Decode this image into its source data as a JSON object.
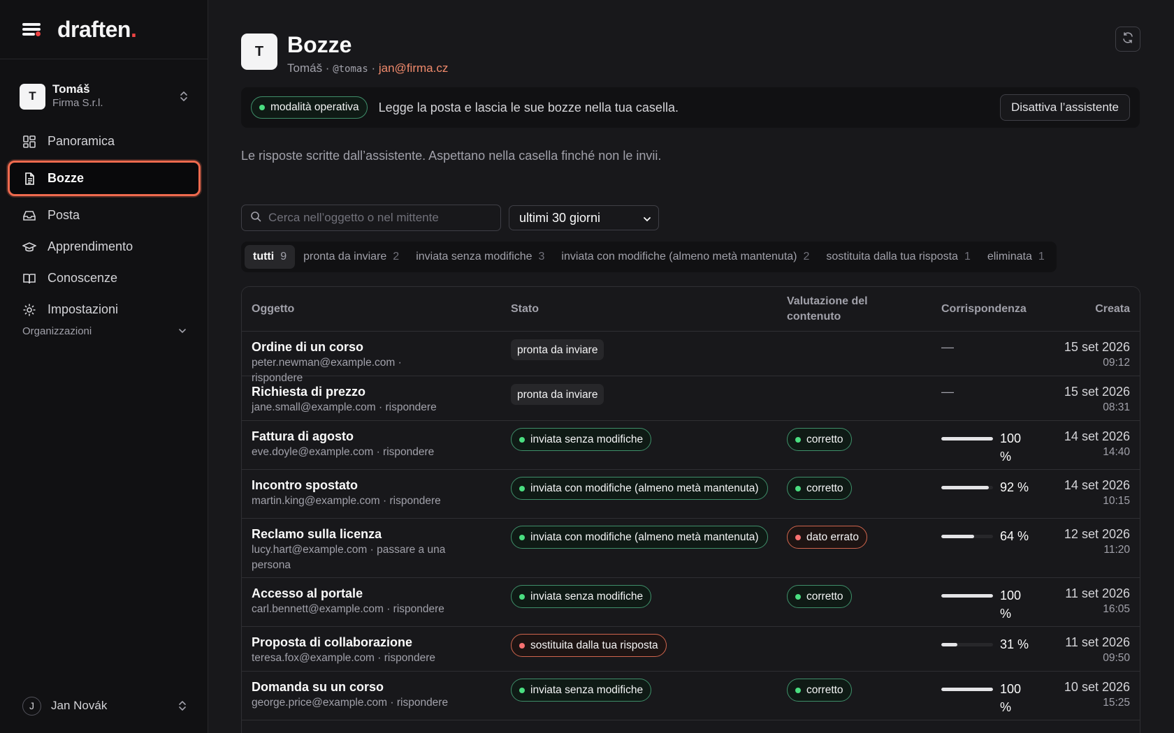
{
  "brand": {
    "logo": "draften",
    "logo_dot": "."
  },
  "account": {
    "initial": "T",
    "name": "Tomáš",
    "org": "Firma S.r.l."
  },
  "nav": [
    {
      "label": "Panoramica",
      "icon": "dashboard-icon"
    },
    {
      "label": "Bozze",
      "icon": "document-icon"
    },
    {
      "label": "Posta",
      "icon": "inbox-icon"
    },
    {
      "label": "Apprendimento",
      "icon": "graduation-cap-icon"
    },
    {
      "label": "Conoscenze",
      "icon": "book-icon"
    },
    {
      "label": "Impostazioni",
      "icon": "gear-icon"
    }
  ],
  "organizations_label": "Organizzazioni",
  "user": {
    "initial": "J",
    "name": "Jan Novák"
  },
  "header": {
    "initial": "T",
    "title": "Bozze",
    "name": "Tomáš",
    "sep1": " · ",
    "handle": "@tomas",
    "sep2": " · ",
    "email": "jan@firma.cz"
  },
  "mode": {
    "badge": "modalità operativa",
    "description": "Legge la posta e lascia le sue bozze nella tua casella.",
    "button": "Disattiva l’assistente"
  },
  "intro": "Le risposte scritte dall’assistente. Aspettano nella casella finché non le invii.",
  "search": {
    "placeholder": "Cerca nell’oggetto o nel mittente"
  },
  "period": {
    "selected": "ultimi 30 giorni"
  },
  "filters": [
    {
      "label": "tutti",
      "count": "9"
    },
    {
      "label": "pronta da inviare",
      "count": "2"
    },
    {
      "label": "inviata senza modifiche",
      "count": "3"
    },
    {
      "label": "inviata con modifiche (almeno metà mantenuta)",
      "count": "2"
    },
    {
      "label": "sostituita dalla tua risposta",
      "count": "1"
    },
    {
      "label": "eliminata",
      "count": "1"
    }
  ],
  "table": {
    "headers": {
      "subject": "Oggetto",
      "status": "Stato",
      "rating": "Valutazione del contenuto",
      "match": "Corrispondenza",
      "created": "Creata"
    },
    "rows": [
      {
        "subject": "Ordine di un corso",
        "meta": "peter.newman@example.com · rispondere",
        "status": "pronta da inviare",
        "status_kind": "neutral",
        "rating": "",
        "rating_kind": "",
        "match": null,
        "match_text": "—",
        "date": "15 set 2026",
        "time": "09:12"
      },
      {
        "subject": "Richiesta di prezzo",
        "meta": "jane.small@example.com · rispondere",
        "status": "pronta da inviare",
        "status_kind": "neutral",
        "rating": "",
        "rating_kind": "",
        "match": null,
        "match_text": "—",
        "date": "15 set 2026",
        "time": "08:31"
      },
      {
        "subject": "Fattura di agosto",
        "meta": "eve.doyle@example.com · rispondere",
        "status": "inviata senza modifiche",
        "status_kind": "green",
        "rating": "corretto",
        "rating_kind": "green",
        "match": 100,
        "match_text": "100 %",
        "date": "14 set 2026",
        "time": "14:40"
      },
      {
        "subject": "Incontro spostato",
        "meta": "martin.king@example.com · rispondere",
        "status": "inviata con modifiche (almeno metà mantenuta)",
        "status_kind": "green",
        "rating": "corretto",
        "rating_kind": "green",
        "match": 92,
        "match_text": "92 %",
        "date": "14 set 2026",
        "time": "10:15"
      },
      {
        "subject": "Reclamo sulla licenza",
        "meta": "lucy.hart@example.com · passare a una persona",
        "status": "inviata con modifiche (almeno metà mantenuta)",
        "status_kind": "green",
        "rating": "dato errato",
        "rating_kind": "red",
        "match": 64,
        "match_text": "64 %",
        "date": "12 set 2026",
        "time": "11:20"
      },
      {
        "subject": "Accesso al portale",
        "meta": "carl.bennett@example.com · rispondere",
        "status": "inviata senza modifiche",
        "status_kind": "green",
        "rating": "corretto",
        "rating_kind": "green",
        "match": 100,
        "match_text": "100 %",
        "date": "11 set 2026",
        "time": "16:05"
      },
      {
        "subject": "Proposta di collaborazione",
        "meta": "teresa.fox@example.com · rispondere",
        "status": "sostituita dalla tua risposta",
        "status_kind": "red",
        "rating": "",
        "rating_kind": "",
        "match": 31,
        "match_text": "31 %",
        "date": "11 set 2026",
        "time": "09:50"
      },
      {
        "subject": "Domanda su un corso",
        "meta": "george.price@example.com · rispondere",
        "status": "inviata senza modifiche",
        "status_kind": "green",
        "rating": "corretto",
        "rating_kind": "green",
        "match": 100,
        "match_text": "100 %",
        "date": "10 set 2026",
        "time": "15:25"
      }
    ]
  }
}
